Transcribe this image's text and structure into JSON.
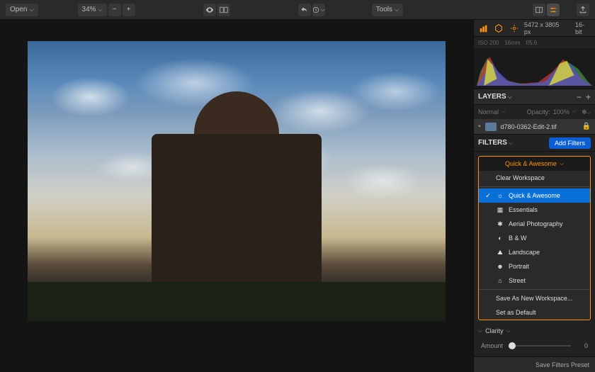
{
  "toolbar": {
    "open_label": "Open",
    "zoom_value": "34%",
    "tools_label": "Tools"
  },
  "info": {
    "dimensions": "5472 x 3805 px",
    "bit_depth": "16-bit",
    "iso": "ISO 200",
    "focal": "16mm",
    "aperture": "f/5.6"
  },
  "layers": {
    "title": "LAYERS",
    "blend_mode": "Normal",
    "opacity_label": "Opacity:",
    "opacity_value": "100%",
    "layer_name": "d780-0362-Edit-2.tif"
  },
  "filters": {
    "title": "FILTERS",
    "add_label": "Add Filters",
    "current_workspace": "Quick & Awesome",
    "menu": {
      "clear": "Clear Workspace",
      "items": [
        {
          "label": "Quick & Awesome",
          "icon": "sun",
          "selected": true
        },
        {
          "label": "Essentials",
          "icon": "grid",
          "selected": false
        },
        {
          "label": "Aerial Photography",
          "icon": "drone",
          "selected": false
        },
        {
          "label": "B & W",
          "icon": "circle",
          "selected": false
        },
        {
          "label": "Landscape",
          "icon": "mountain",
          "selected": false
        },
        {
          "label": "Portrait",
          "icon": "person",
          "selected": false
        },
        {
          "label": "Street",
          "icon": "building",
          "selected": false
        }
      ],
      "save_as": "Save As New Workspace...",
      "set_default": "Set as Default"
    },
    "clarity_label": "Clarity",
    "amount_label": "Amount",
    "amount_value": "0"
  },
  "bottom": {
    "save_preset": "Save Filters Preset"
  }
}
